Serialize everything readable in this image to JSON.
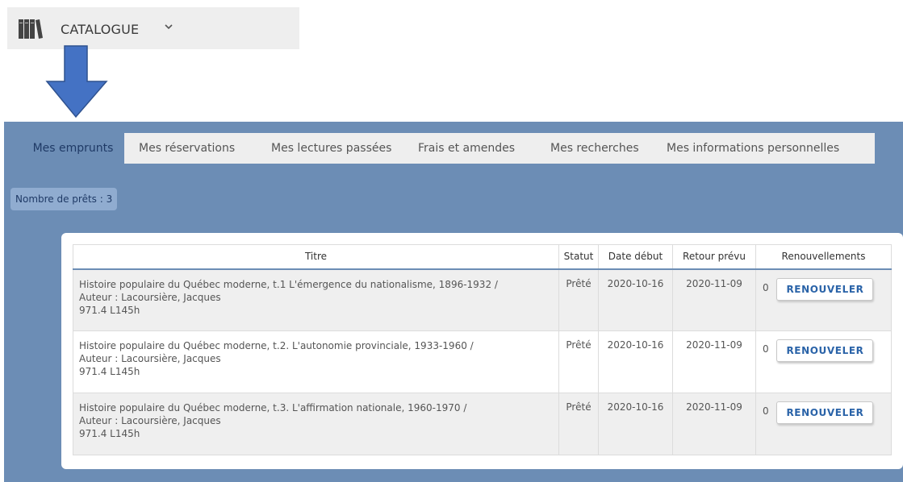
{
  "catalogue": {
    "label": "CATALOGUE",
    "icon": "books-icon",
    "dropdown_icon": "chevron-down-icon"
  },
  "tabs": [
    {
      "label": "Mes emprunts",
      "active": true
    },
    {
      "label": "Mes réservations",
      "active": false
    },
    {
      "label": "Mes lectures passées",
      "active": false
    },
    {
      "label": "Frais et amendes",
      "active": false
    },
    {
      "label": "Mes recherches",
      "active": false
    },
    {
      "label": "Mes informations personnelles",
      "active": false
    }
  ],
  "loan_count": "Nombre de prêts : 3",
  "table": {
    "headers": {
      "titre": "Titre",
      "statut": "Statut",
      "debut": "Date début",
      "retour": "Retour prévu",
      "renew": "Renouvellements"
    },
    "rows": [
      {
        "title": "Histoire populaire du Québec moderne, t.1 L'émergence du nationalisme, 1896-1932 /",
        "author": "Auteur : Lacoursière, Jacques",
        "call": "971.4 L145h",
        "statut": "Prêté",
        "debut": "2020-10-16",
        "retour": "2020-11-09",
        "count": "0",
        "button": "RENOUVELER"
      },
      {
        "title": "Histoire populaire du Québec moderne, t.2. L'autonomie provinciale, 1933-1960 /",
        "author": "Auteur : Lacoursière, Jacques",
        "call": "971.4 L145h",
        "statut": "Prêté",
        "debut": "2020-10-16",
        "retour": "2020-11-09",
        "count": "0",
        "button": "RENOUVELER"
      },
      {
        "title": "Histoire populaire du Québec moderne, t.3. L'affirmation nationale, 1960-1970 /",
        "author": "Auteur : Lacoursière, Jacques",
        "call": "971.4 L145h",
        "statut": "Prêté",
        "debut": "2020-10-16",
        "retour": "2020-11-09",
        "count": "0",
        "button": "RENOUVELER"
      }
    ]
  },
  "colors": {
    "panel": "#6c8db5",
    "arrow": "#4472c4",
    "button_text": "#2a63a8"
  }
}
